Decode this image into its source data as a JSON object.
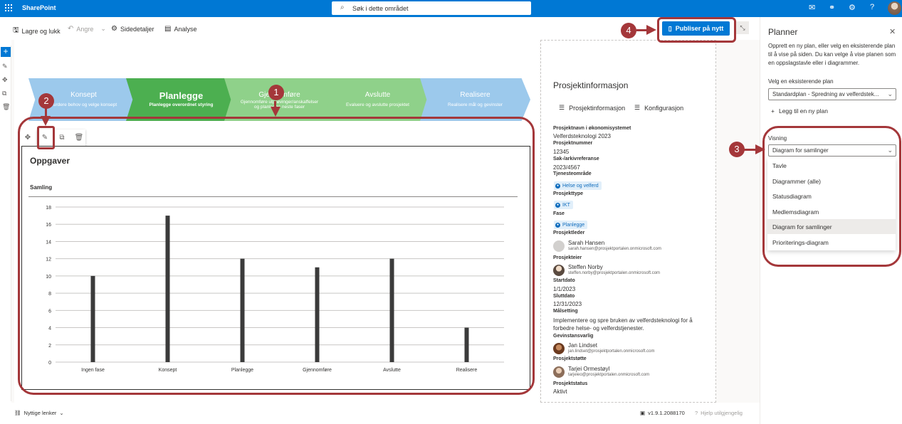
{
  "suite": {
    "brand": "SharePoint",
    "search_placeholder": "Søk i dette området"
  },
  "commands": {
    "save_close": "Lagre og lukk",
    "undo": "Angre",
    "page_details": "Sidedetaljer",
    "analytics": "Analyse",
    "publish": "Publiser på nytt"
  },
  "phases": [
    {
      "title": "Konsept",
      "subtitle": "Vurdere behov og velge konsept",
      "color": "#9cc9ec"
    },
    {
      "title": "Planlegge",
      "subtitle": "Planlegge overordnet styring",
      "color": "#4caf50"
    },
    {
      "title": "Gjennomføre",
      "subtitle": "Gjennomføre utprøvinger/anskaffelser og planlegge neste faser",
      "color": "#8fd18a"
    },
    {
      "title": "Avslutte",
      "subtitle": "Evaluere og avslutte prosjektet",
      "color": "#8fd18a"
    },
    {
      "title": "Realisere",
      "subtitle": "Realisere mål og gevinster",
      "color": "#9cc9ec"
    }
  ],
  "chart_header": {
    "title": "Oppgaver",
    "subtitle": "Samling"
  },
  "chart_data": {
    "type": "bar",
    "categories": [
      "Ingen fase",
      "Konsept",
      "Planlegge",
      "Gjennomføre",
      "Avslutte",
      "Realisere"
    ],
    "values": [
      10,
      17,
      12,
      11,
      12,
      4
    ],
    "ylim": [
      0,
      18
    ],
    "yticks": [
      0,
      2,
      4,
      6,
      8,
      10,
      12,
      14,
      16,
      18
    ],
    "grid": true,
    "bar_color": "#3b3b3b"
  },
  "project_info": {
    "title": "Prosjektinformasjon",
    "tab_info": "Prosjektinformasjon",
    "tab_config": "Konfigurasjon",
    "fields": {
      "name_label": "Prosjektnavn i økonomisystemet",
      "name_value": "Velferdsteknologi 2023",
      "number_label": "Prosjektnummer",
      "number_value": "12345",
      "archive_label": "Sak-/arkivreferanse",
      "archive_value": "2023/4567",
      "service_label": "Tjenesteområde",
      "service_tag": "Helse og velferd",
      "type_label": "Prosjekttype",
      "type_tag": "IKT",
      "phase_label": "Fase",
      "phase_tag": "Planlegge",
      "leader_label": "Prosjektleder",
      "leader_name": "Sarah Hansen",
      "leader_email": "sarah.hansen@prosjektportalen.onmicrosoft.com",
      "owner_label": "Prosjekteier",
      "owner_name": "Steffen Norby",
      "owner_email": "steffen.norby@prosjektportalen.onmicrosoft.com",
      "start_label": "Startdato",
      "start_value": "1/1/2023",
      "end_label": "Sluttdato",
      "end_value": "12/31/2023",
      "goal_label": "Målsetting",
      "goal_value": "Implementere og spre bruken av velferdsteknologi for å forbedre helse- og velferdstjenester.",
      "benefit_label": "Gevinstansvarlig",
      "benefit_name": "Jan Lindset",
      "benefit_email": "jan.lindset@prosjektportalen.onmicrosoft.com",
      "support_label": "Prosjektstøtte",
      "support_name": "Tarjei Ormestøyl",
      "support_email": "tarjeieo@prosjektportalen.onmicrosoft.com",
      "status_label": "Prosjektstatus",
      "status_value": "Aktivt"
    }
  },
  "planner": {
    "title": "Planner",
    "description": "Opprett en ny plan, eller velg en eksisterende plan til å vise på siden. Du kan velge å vise planen som en oppslagstavle eller i diagrammer.",
    "plan_label": "Velg en eksisterende plan",
    "plan_value": "Standardplan - Spredning av velferdstek...",
    "add_plan": "Legg til en ny plan",
    "view_label": "Visning",
    "view_value": "Diagram for samlinger",
    "view_options": [
      "Tavle",
      "Diagrammer (alle)",
      "Statusdiagram",
      "Medlemsdiagram",
      "Diagram for samlinger",
      "Prioriterings-diagram"
    ],
    "view_selected_index": 4
  },
  "callouts": [
    "1",
    "2",
    "3",
    "4"
  ],
  "footer": {
    "links": "Nyttige lenker",
    "version": "v1.9.1.2088170",
    "help": "Hjelp utilgjengelig"
  }
}
